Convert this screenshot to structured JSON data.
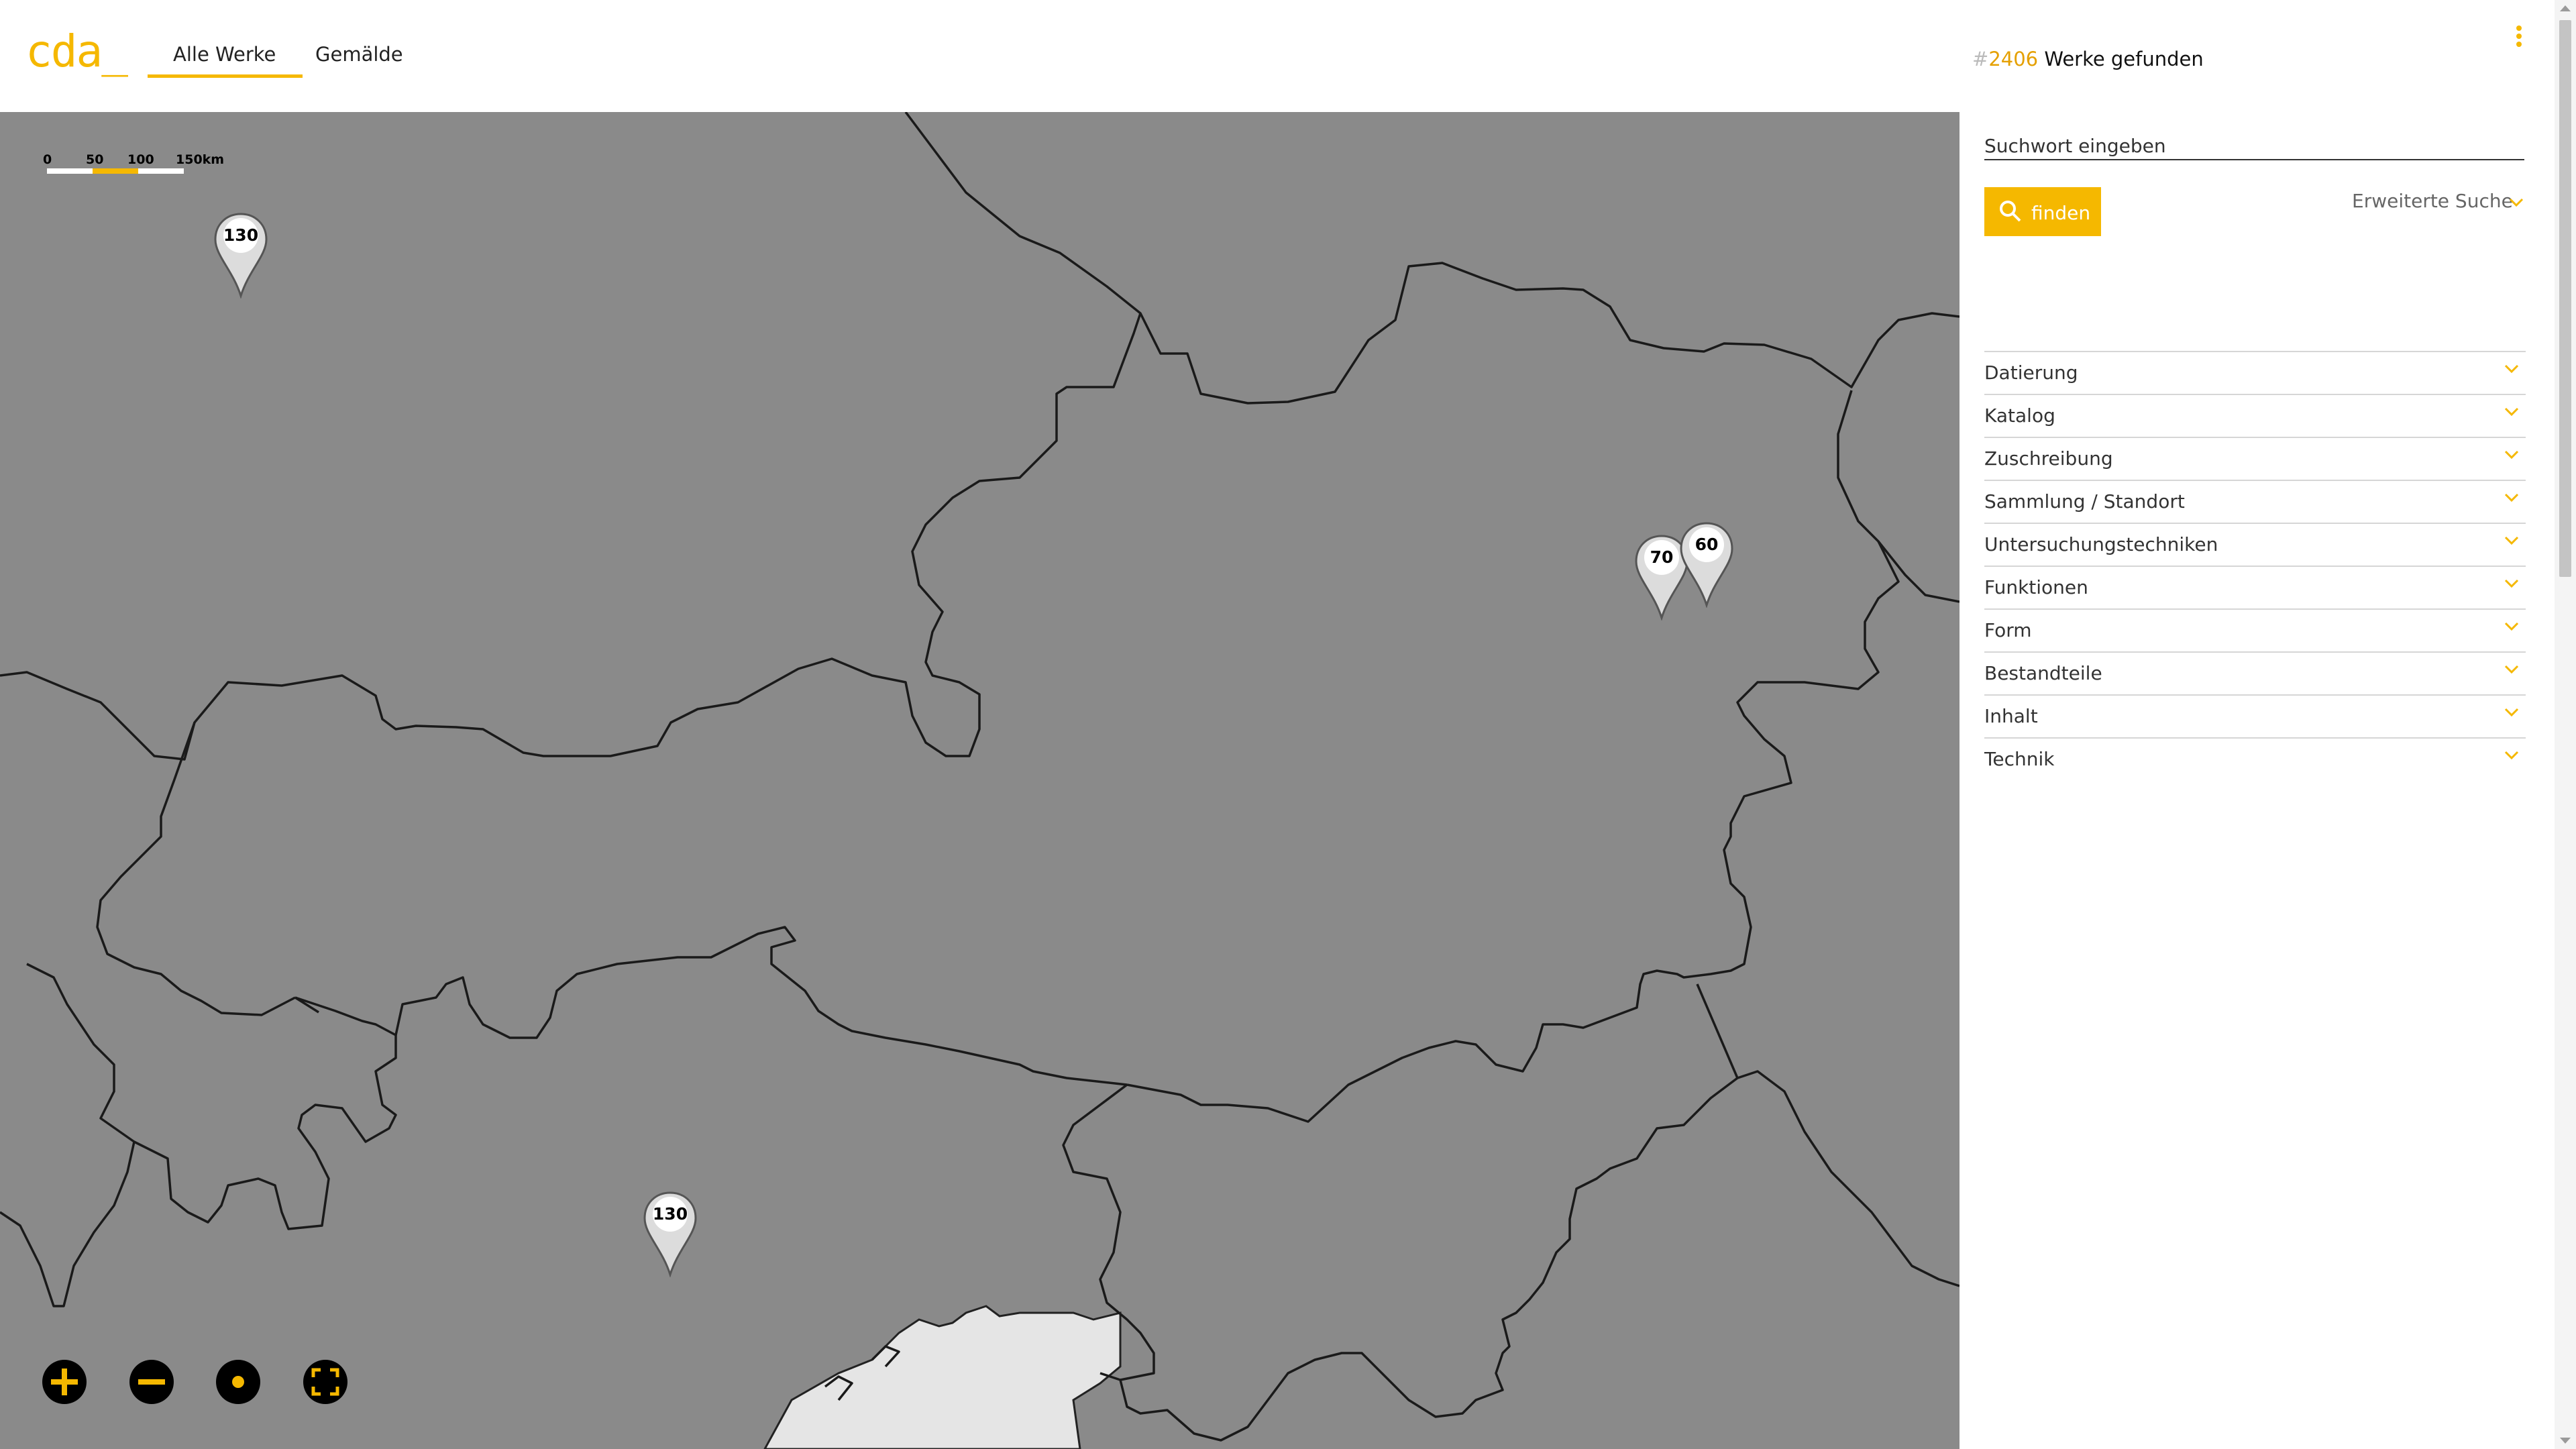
{
  "app": {
    "logo": "cda_"
  },
  "nav": {
    "tabs": [
      {
        "label": "Alle Werke",
        "active": true
      },
      {
        "label": "Gemälde",
        "active": false
      }
    ]
  },
  "results": {
    "hash": "#",
    "count": "2406",
    "label": "Werke gefunden"
  },
  "map": {
    "scale": {
      "labels": [
        "0",
        "50",
        "100",
        "150km"
      ]
    },
    "markers": [
      {
        "label": "130"
      },
      {
        "label": "70"
      },
      {
        "label": "60"
      },
      {
        "label": "130"
      }
    ],
    "controls": [
      "zoom-in",
      "zoom-out",
      "center",
      "fullscreen"
    ]
  },
  "search": {
    "placeholder": "Suchwort eingeben",
    "button_label": "finden",
    "advanced_label": "Erweiterte Suche"
  },
  "facets": [
    "Datierung",
    "Katalog",
    "Zuschreibung",
    "Sammlung / Standort",
    "Untersuchungstechniken",
    "Funktionen",
    "Form",
    "Bestandteile",
    "Inhalt",
    "Technik"
  ],
  "colors": {
    "accent": "#f5b800",
    "map_bg": "#8a8a8a",
    "lake": "#e5e5e5"
  }
}
